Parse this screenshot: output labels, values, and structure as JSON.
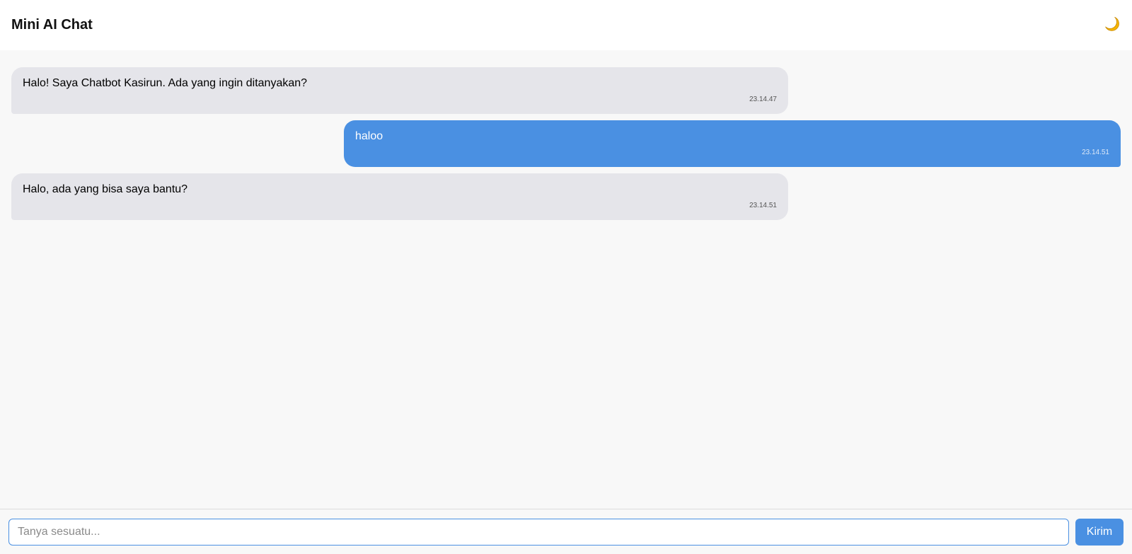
{
  "header": {
    "title": "Mini AI Chat",
    "theme_icon": "moon-icon"
  },
  "messages": [
    {
      "sender": "bot",
      "text": "Halo! Saya Chatbot Kasirun. Ada yang ingin ditanyakan?",
      "time": "23.14.47"
    },
    {
      "sender": "user",
      "text": "haloo",
      "time": "23.14.51"
    },
    {
      "sender": "bot",
      "text": "Halo, ada yang bisa saya bantu?",
      "time": "23.14.51"
    }
  ],
  "composer": {
    "placeholder": "Tanya sesuatu...",
    "value": "",
    "send_label": "Kirim"
  },
  "colors": {
    "accent": "#4a90e2",
    "bot_bubble": "#e5e5ea",
    "background": "#f8f8f8",
    "moon": "#f5b400"
  }
}
